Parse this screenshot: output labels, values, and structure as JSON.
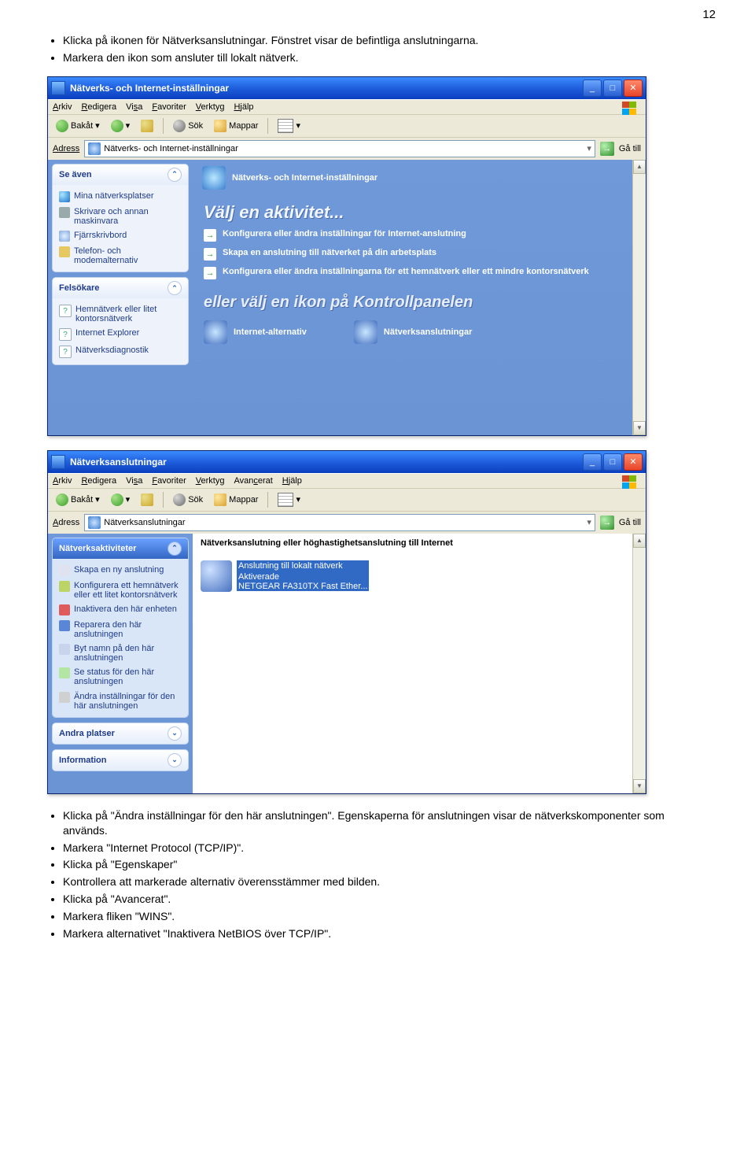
{
  "page_number": "12",
  "intro_bullets": [
    "Klicka på ikonen för Nätverksanslutningar. Fönstret visar de befintliga anslutningarna.",
    "Markera den ikon som ansluter till lokalt nätverk."
  ],
  "win1": {
    "title": "Nätverks- och Internet-inställningar",
    "menus": [
      "Arkiv",
      "Redigera",
      "Visa",
      "Favoriter",
      "Verktyg",
      "Hjälp"
    ],
    "toolbar": {
      "back": "Bakåt",
      "sok": "Sök",
      "mappar": "Mappar"
    },
    "addr_label": "Adress",
    "addr_value": "Nätverks- och Internet-inställningar",
    "go": "Gå till",
    "sidepanel1": {
      "head": "Se även",
      "items": [
        "Mina nätverksplatser",
        "Skrivare och annan maskinvara",
        "Fjärrskrivbord",
        "Telefon- och modemalternativ"
      ]
    },
    "sidepanel2": {
      "head": "Felsökare",
      "items": [
        "Hemnätverk eller litet kontorsnätverk",
        "Internet Explorer",
        "Nätverksdiagnostik"
      ]
    },
    "cat_title": "Nätverks- och Internet-inställningar",
    "big1": "Välj en aktivitet...",
    "tasks": [
      "Konfigurera eller ändra inställningar för Internet-anslutning",
      "Skapa en anslutning till nätverket på din arbetsplats",
      "Konfigurera eller ändra inställningarna för ett hemnätverk eller ett mindre kontorsnätverk"
    ],
    "big2": "eller välj en ikon på Kontrollpanelen",
    "icons": [
      "Internet-alternativ",
      "Nätverksanslutningar"
    ]
  },
  "win2": {
    "title": "Nätverksanslutningar",
    "menus": [
      "Arkiv",
      "Redigera",
      "Visa",
      "Favoriter",
      "Verktyg",
      "Avancerat",
      "Hjälp"
    ],
    "toolbar": {
      "back": "Bakåt",
      "sok": "Sök",
      "mappar": "Mappar"
    },
    "addr_label": "Adress",
    "addr_value": "Nätverksanslutningar",
    "go": "Gå till",
    "panel_act": {
      "head": "Nätverksaktiviteter",
      "items": [
        "Skapa en ny anslutning",
        "Konfigurera ett hemnätverk eller ett litet kontorsnätverk",
        "Inaktivera den här enheten",
        "Reparera den här anslutningen",
        "Byt namn på den här anslutningen",
        "Se status för den här anslutningen",
        "Ändra inställningar för den här anslutningen"
      ]
    },
    "panel_other": "Andra platser",
    "panel_info": "Information",
    "cat_title2": "Nätverksanslutning eller höghastighetsanslutning till Internet",
    "lan": {
      "name": "Anslutning till lokalt nätverk",
      "status": "Aktiverade",
      "device": "NETGEAR FA310TX Fast Ether..."
    }
  },
  "outro_bullets": [
    "Klicka på \"Ändra inställningar för den här anslutningen\". Egenskaperna för anslutningen visar de nätverkskomponenter som används.",
    "Markera \"Internet Protocol (TCP/IP)\".",
    "Klicka på \"Egenskaper\"",
    "Kontrollera att markerade alternativ överensstämmer med bilden.",
    "Klicka på \"Avancerat\".",
    "Markera fliken \"WINS\".",
    "Markera alternativet \"Inaktivera NetBIOS över TCP/IP\"."
  ]
}
